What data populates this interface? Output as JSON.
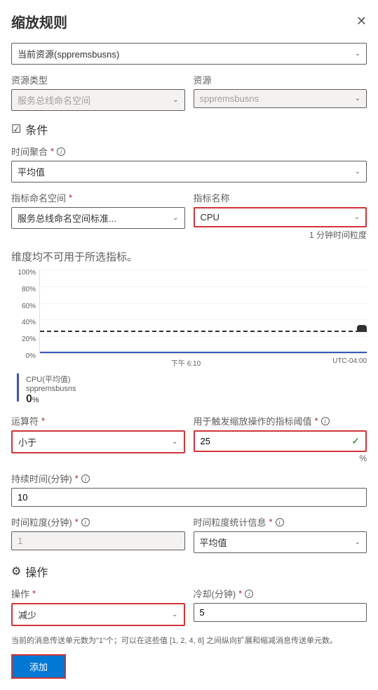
{
  "header": {
    "title": "缩放规则",
    "close_icon": "✕"
  },
  "resource_selector": {
    "value": "当前资源(sppremsbusns)"
  },
  "resource_type": {
    "label": "资源类型",
    "value": "服务总线命名空间"
  },
  "resource": {
    "label": "资源",
    "value": "sppremsbusns"
  },
  "condition_section": {
    "title": "条件"
  },
  "time_aggregation": {
    "label": "时间聚合",
    "value": "平均值"
  },
  "metric_namespace": {
    "label": "指标命名空间",
    "value": "服务总线命名空间标准..."
  },
  "metric_name": {
    "label": "指标名称",
    "value": "CPU"
  },
  "time_grain_hint": "1 分钟时间粒度",
  "dimension_warning": "维度均不可用于所选指标。",
  "chart_data": {
    "type": "line",
    "y_ticks": [
      "100%",
      "80%",
      "60%",
      "40%",
      "20%",
      "0%"
    ],
    "x_ticks": [
      "下午 6:10",
      "UTC-04:00"
    ],
    "threshold_line": 25,
    "series": [
      {
        "name": "CPU",
        "values": [
          0
        ]
      }
    ]
  },
  "legend": {
    "metric": "CPU(平均值)",
    "resource": "sppremsbusns",
    "value": "0",
    "unit": "%"
  },
  "operator": {
    "label": "运算符",
    "value": "小于"
  },
  "threshold": {
    "label": "用于触发缩放操作的指标阈值",
    "value": "25",
    "unit": "%"
  },
  "duration": {
    "label": "持续时间(分钟)",
    "value": "10"
  },
  "time_grain": {
    "label": "时间粒度(分钟)",
    "value": "1"
  },
  "time_grain_statistic": {
    "label": "时间粒度统计信息",
    "value": "平均值"
  },
  "action_section": {
    "title": "操作"
  },
  "action": {
    "label": "操作",
    "value": "减少"
  },
  "cooldown": {
    "label": "冷却(分钟)",
    "value": "5"
  },
  "helper_text": "当前的消息传送单元数为\"1\"个；可以在这些值 [1, 2, 4, 8] 之间纵向扩展和缩减消息传送单元数。",
  "add_button": "添加"
}
